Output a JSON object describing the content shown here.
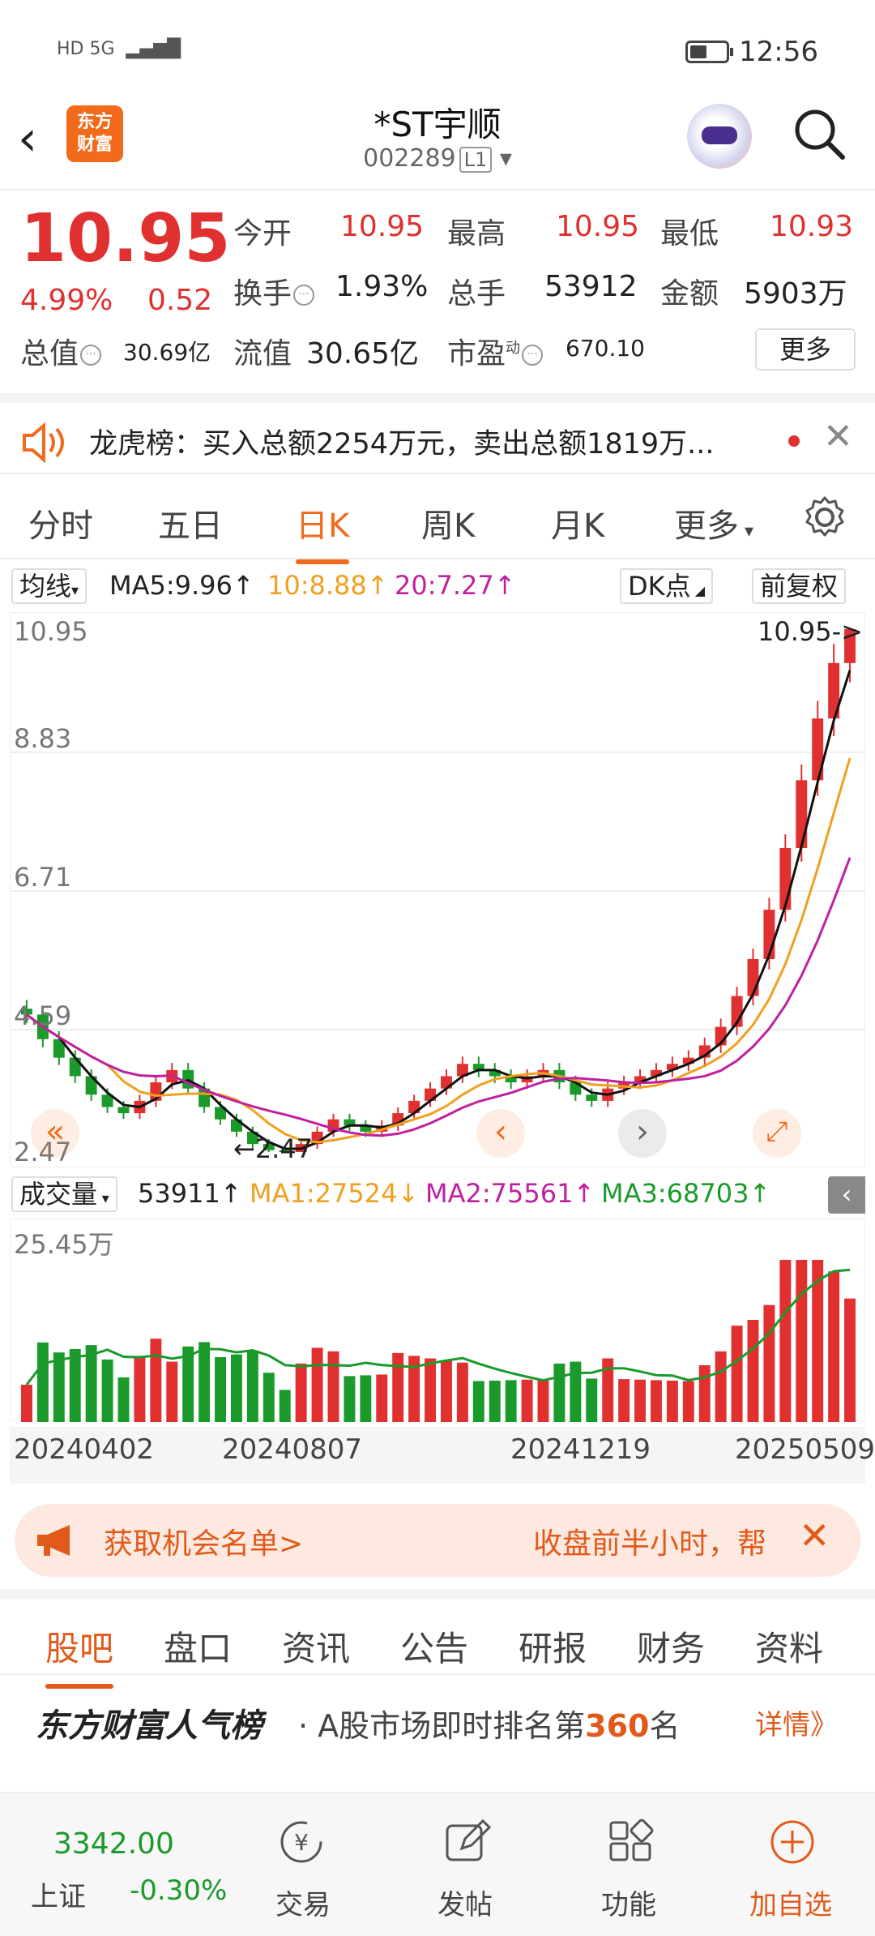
{
  "status": {
    "network": "HD 5G",
    "time": "12:56"
  },
  "header": {
    "back": "‹",
    "logo_line1": "东方",
    "logo_line2": "财富",
    "name": "*ST宇顺",
    "code": "002289",
    "level": "L1"
  },
  "quote": {
    "price": "10.95",
    "pct": "4.99%",
    "chg": "0.52",
    "open_label": "今开",
    "open": "10.95",
    "high_label": "最高",
    "high": "10.95",
    "low_label": "最低",
    "low": "10.93",
    "turnover_label": "换手",
    "turnover": "1.93%",
    "volume_label": "总手",
    "volume": "53912",
    "amount_label": "金额",
    "amount": "5903万",
    "mcap_label": "总值",
    "mcap": "30.69亿",
    "float_label": "流值",
    "float": "30.65亿",
    "pe_label": "市盈",
    "pe_sup": "动",
    "pe": "670.10",
    "more": "更多"
  },
  "notice": {
    "text": "龙虎榜：买入总额2254万元，卖出总额1819万..."
  },
  "tabs": [
    "分时",
    "五日",
    "日K",
    "周K",
    "月K",
    "更多"
  ],
  "ma": {
    "dropdown": "均线",
    "ma5": "MA5:9.96↑",
    "ma10": "10:8.88↑",
    "ma20": "20:7.27↑",
    "dk": "DK点",
    "fq": "前复权"
  },
  "kline": {
    "y_labels": [
      "10.95",
      "8.83",
      "6.71",
      "4.59",
      "2.47"
    ],
    "last_label": "10.95->",
    "min_label": "←2.47"
  },
  "vol": {
    "dropdown": "成交量",
    "v": "53911↑",
    "ma1": "MA1:27524↓",
    "ma2": "MA2:75561↑",
    "ma3": "MA3:68703↑",
    "ylabel": "25.45万"
  },
  "dates": [
    "20240402",
    "20240807",
    "20241219",
    "20250509"
  ],
  "banner": {
    "left": "获取机会名单>",
    "right": "收盘前半小时，帮"
  },
  "sectabs": [
    "股吧",
    "盘口",
    "资讯",
    "公告",
    "研报",
    "财务",
    "资料"
  ],
  "rank": {
    "brand": "东方财富人气榜",
    "prefix": "· A股市场即时排名第",
    "num": "360",
    "suffix": "名",
    "detail": "详情》"
  },
  "bottom": {
    "index_value": "3342.00",
    "index_name": "上证",
    "index_chg": "-0.30%",
    "trade": "交易",
    "post": "发帖",
    "func": "功能",
    "add": "加自选"
  },
  "colors": {
    "up": "#e03030",
    "down": "#1a9a2a",
    "accent": "#f26a1b",
    "ma10": "#f0a020",
    "ma20": "#c020a0"
  },
  "chart_data": {
    "type": "candlestick",
    "ylim": [
      2.47,
      10.95
    ],
    "close": [
      4.7,
      4.3,
      4.0,
      3.7,
      3.4,
      3.2,
      3.1,
      3.3,
      3.6,
      3.8,
      3.5,
      3.2,
      3.0,
      2.8,
      2.6,
      2.5,
      2.47,
      2.6,
      2.8,
      3.0,
      2.9,
      2.8,
      2.9,
      3.1,
      3.3,
      3.5,
      3.7,
      3.9,
      3.8,
      3.7,
      3.6,
      3.7,
      3.8,
      3.6,
      3.4,
      3.3,
      3.5,
      3.6,
      3.7,
      3.8,
      3.9,
      4.0,
      4.2,
      4.5,
      5.0,
      5.6,
      6.4,
      7.4,
      8.5,
      9.5,
      10.4,
      10.95
    ]
  }
}
